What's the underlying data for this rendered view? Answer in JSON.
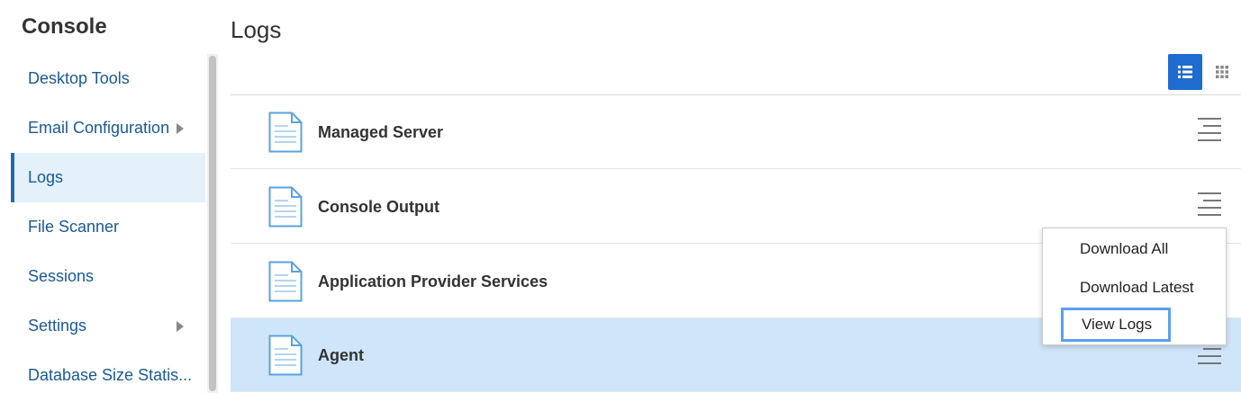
{
  "app": {
    "title": "Console"
  },
  "sidebar": {
    "items": [
      {
        "label": "Desktop Tools",
        "has_submenu": false,
        "active": false
      },
      {
        "label": "Email Configuration",
        "has_submenu": true,
        "active": false
      },
      {
        "label": "Logs",
        "has_submenu": false,
        "active": true
      },
      {
        "label": "File Scanner",
        "has_submenu": false,
        "active": false
      },
      {
        "label": "Sessions",
        "has_submenu": false,
        "active": false
      },
      {
        "label": "Settings",
        "has_submenu": true,
        "active": false
      },
      {
        "label": "Database Size Statis...",
        "has_submenu": false,
        "active": false
      }
    ]
  },
  "main": {
    "title": "Logs",
    "view_mode": "list",
    "rows": [
      {
        "name": "Managed Server",
        "selected": false
      },
      {
        "name": "Console Output",
        "selected": false
      },
      {
        "name": "Application Provider Services",
        "selected": false
      },
      {
        "name": "Agent",
        "selected": true
      }
    ]
  },
  "dropdown": {
    "items": [
      {
        "label": "Download All",
        "focused": false
      },
      {
        "label": "Download Latest",
        "focused": false
      },
      {
        "label": "View Logs",
        "focused": true
      }
    ]
  },
  "colors": {
    "accent": "#1f6bcf",
    "link": "#1a5a96",
    "selected_row": "#cfe6fa",
    "active_sidebar": "#e4f0fa",
    "focus_ring": "#5aa0f2"
  }
}
